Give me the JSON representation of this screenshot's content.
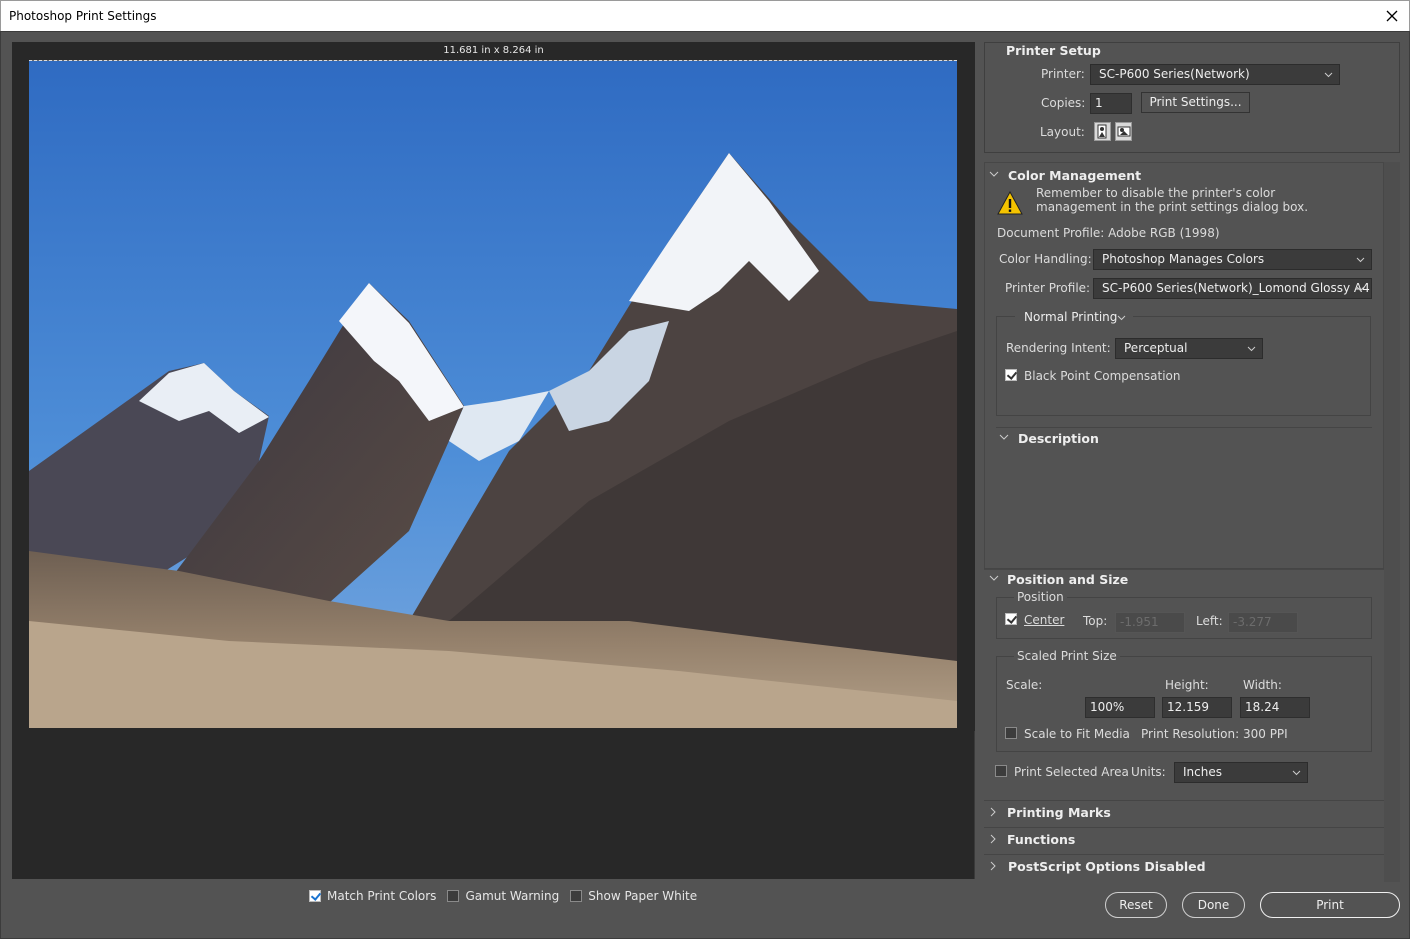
{
  "window": {
    "title": "Photoshop Print Settings"
  },
  "preview": {
    "paper_size": "11.681 in x 8.264 in"
  },
  "bottom_options": {
    "match_print_colors": {
      "label": "Match Print Colors",
      "checked": true
    },
    "gamut_warning": {
      "label": "Gamut Warning",
      "checked": false
    },
    "show_paper_white": {
      "label": "Show Paper White",
      "checked": false
    }
  },
  "printer_setup": {
    "title": "Printer Setup",
    "printer_label": "Printer:",
    "printer_value": "SC-P600 Series(Network)",
    "copies_label": "Copies:",
    "copies_value": "1",
    "print_settings_button": "Print Settings...",
    "layout_label": "Layout:"
  },
  "color_management": {
    "title": "Color Management",
    "warning_line1": "Remember to disable the printer's color",
    "warning_line2": "management in the print settings dialog box.",
    "document_profile": "Document Profile: Adobe RGB (1998)",
    "color_handling_label": "Color Handling:",
    "color_handling_value": "Photoshop Manages Colors",
    "printer_profile_label": "Printer Profile:",
    "printer_profile_value": "SC-P600 Series(Network)_Lomond Glossy A4...",
    "printing_mode_value": "Normal Printing",
    "rendering_intent_label": "Rendering Intent:",
    "rendering_intent_value": "Perceptual",
    "black_point_label": "Black Point Compensation",
    "black_point_checked": true
  },
  "description": {
    "title": "Description"
  },
  "position_and_size": {
    "title": "Position and Size",
    "position_group": "Position",
    "center_label": "Center",
    "center_checked": true,
    "top_label": "Top:",
    "top_value": "-1.951",
    "left_label": "Left:",
    "left_value": "-3.277",
    "scaled_group": "Scaled Print Size",
    "scale_label": "Scale:",
    "height_label": "Height:",
    "width_label": "Width:",
    "scale_value": "100%",
    "height_value": "12.159",
    "width_value": "18.24",
    "scale_to_fit_label": "Scale to Fit Media",
    "print_resolution": "Print Resolution: 300 PPI",
    "print_selected_area_label": "Print Selected Area",
    "units_label": "Units:",
    "units_value": "Inches"
  },
  "collapsed_sections": {
    "printing_marks": "Printing Marks",
    "functions": "Functions",
    "postscript": "PostScript Options Disabled"
  },
  "footer": {
    "reset": "Reset",
    "done": "Done",
    "print": "Print"
  }
}
